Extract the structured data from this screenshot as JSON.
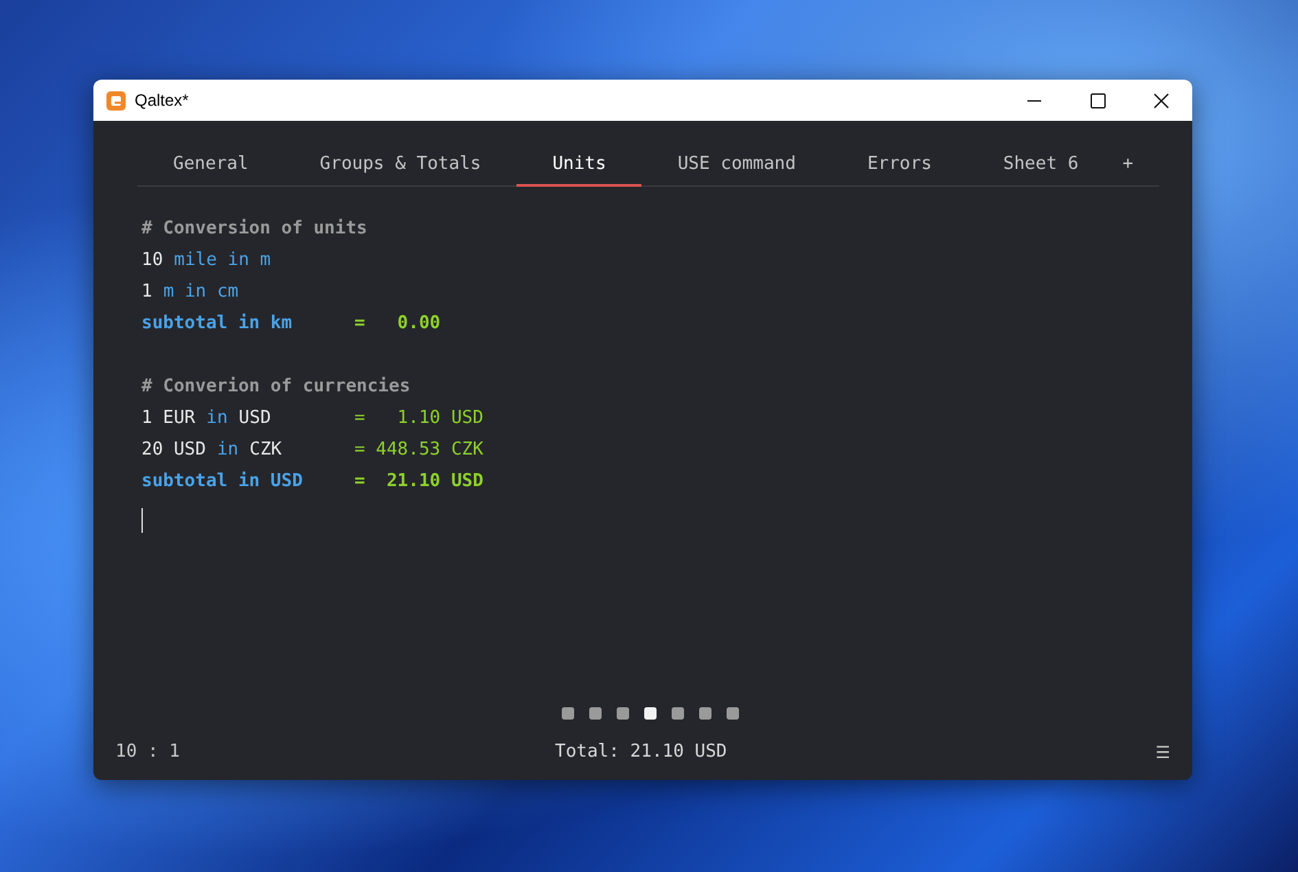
{
  "window": {
    "title": "Qaltex*"
  },
  "tabs": [
    {
      "label": "General",
      "selected": false
    },
    {
      "label": "Groups & Totals",
      "selected": false
    },
    {
      "label": "Units",
      "selected": true
    },
    {
      "label": "USE command",
      "selected": false
    },
    {
      "label": "Errors",
      "selected": false
    },
    {
      "label": "Sheet 6",
      "selected": false
    },
    {
      "label": "+",
      "selected": false
    }
  ],
  "editor": {
    "lines": [
      {
        "kind": "comment",
        "tokens": [
          {
            "text": "# Conversion of units",
            "kind": "comment"
          }
        ]
      },
      {
        "kind": "plain",
        "tokens": [
          {
            "text": "10",
            "kind": "number"
          },
          {
            "text": "mile in m",
            "kind": "unit"
          }
        ]
      },
      {
        "kind": "plain",
        "tokens": [
          {
            "text": "1",
            "kind": "number"
          },
          {
            "text": "m in cm",
            "kind": "unit"
          }
        ]
      },
      {
        "kind": "subtotal",
        "tokens": [
          {
            "text": "subtotal in km",
            "kind": "unit"
          }
        ],
        "result": "=   0.00"
      },
      {
        "kind": "blank"
      },
      {
        "kind": "comment",
        "tokens": [
          {
            "text": "# Converion of currencies",
            "kind": "comment"
          }
        ]
      },
      {
        "kind": "plain",
        "tokens": [
          {
            "text": "1 EUR",
            "kind": "number"
          },
          {
            "text": "in",
            "kind": "unit"
          },
          {
            "text": "USD",
            "kind": "number"
          }
        ],
        "result": "=   1.10 USD"
      },
      {
        "kind": "plain",
        "tokens": [
          {
            "text": "20 USD",
            "kind": "number"
          },
          {
            "text": "in",
            "kind": "unit"
          },
          {
            "text": "CZK",
            "kind": "number"
          }
        ],
        "result": "= 448.53 CZK"
      },
      {
        "kind": "subtotal",
        "tokens": [
          {
            "text": "subtotal in USD",
            "kind": "unit"
          }
        ],
        "result": "=  21.10 USD"
      },
      {
        "kind": "cursor"
      }
    ]
  },
  "pages": [
    {
      "selected": false
    },
    {
      "selected": false
    },
    {
      "selected": false
    },
    {
      "selected": true
    },
    {
      "selected": false
    },
    {
      "selected": false
    },
    {
      "selected": false
    }
  ],
  "status_bar": {
    "position": "10 : 1",
    "total": "Total: 21.10 USD",
    "menu": "☰"
  }
}
